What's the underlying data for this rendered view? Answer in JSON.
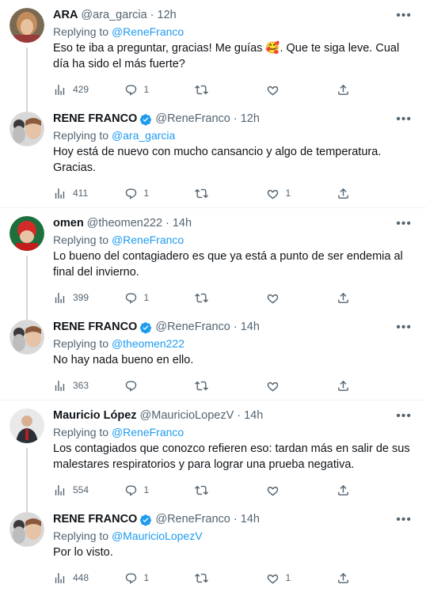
{
  "replying_prefix": "Replying to",
  "tweets": [
    {
      "name": "ARA",
      "verified": false,
      "handle": "@ara_garcia",
      "time": "12h",
      "replying_to": "@ReneFranco",
      "text": "Eso te iba a preguntar, gracias! Me guías 🥰. Que te siga leve. Cual día ha sido el más fuerte?",
      "views": "429",
      "replies": "1",
      "retweets": "",
      "likes": ""
    },
    {
      "name": "RENE FRANCO",
      "verified": true,
      "handle": "@ReneFranco",
      "time": "12h",
      "replying_to": "@ara_garcia",
      "text": "Hoy está de nuevo con mucho cansancio y algo de temperatura. Gracias.",
      "views": "411",
      "replies": "1",
      "retweets": "",
      "likes": "1"
    },
    {
      "name": "omen",
      "verified": false,
      "handle": "@theomen222",
      "time": "14h",
      "replying_to": "@ReneFranco",
      "text": "Lo bueno del contagiadero es que ya está a punto de ser endemia al final del invierno.",
      "views": "399",
      "replies": "1",
      "retweets": "",
      "likes": ""
    },
    {
      "name": "RENE FRANCO",
      "verified": true,
      "handle": "@ReneFranco",
      "time": "14h",
      "replying_to": "@theomen222",
      "text": "No hay nada bueno en ello.",
      "views": "363",
      "replies": "",
      "retweets": "",
      "likes": ""
    },
    {
      "name": "Mauricio López",
      "verified": false,
      "handle": "@MauricioLopezV",
      "time": "14h",
      "replying_to": "@ReneFranco",
      "text": "Los contagiados que conozco refieren eso: tardan más en salir de sus malestares respiratorios y para lograr una prueba negativa.",
      "views": "554",
      "replies": "1",
      "retweets": "",
      "likes": ""
    },
    {
      "name": "RENE FRANCO",
      "verified": true,
      "handle": "@ReneFranco",
      "time": "14h",
      "replying_to": "@MauricioLopezV",
      "text": "Por lo visto.",
      "views": "448",
      "replies": "1",
      "retweets": "",
      "likes": "1"
    }
  ],
  "colors": {
    "accent": "#1d9bf0",
    "muted": "#536471",
    "text": "#0f1419",
    "thread_line": "#cfd9de"
  },
  "icons": [
    "views-icon",
    "reply-icon",
    "retweet-icon",
    "like-icon",
    "share-icon",
    "verified-badge-icon",
    "more-icon"
  ]
}
